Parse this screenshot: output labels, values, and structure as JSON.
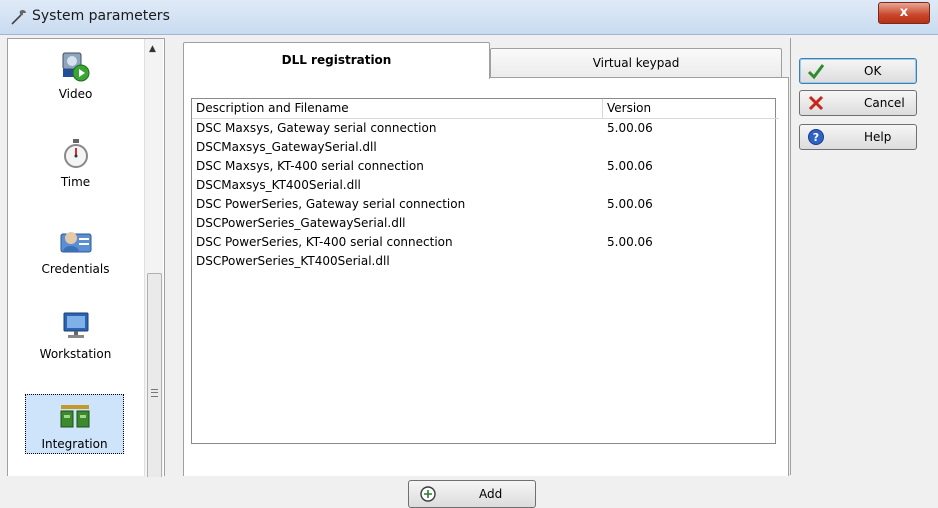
{
  "window": {
    "title": "System parameters",
    "close_label": "x"
  },
  "sidebar": {
    "items": [
      {
        "label": "Video"
      },
      {
        "label": "Time"
      },
      {
        "label": "Credentials"
      },
      {
        "label": "Workstation"
      },
      {
        "label": "Integration",
        "selected": true
      }
    ]
  },
  "tabs": [
    {
      "label": "DLL registration",
      "active": true
    },
    {
      "label": "Virtual keypad",
      "active": false
    }
  ],
  "dll_list": {
    "columns": [
      "Description and Filename",
      "Version"
    ],
    "rows": [
      {
        "description": "DSC Maxsys, Gateway serial connection",
        "version": "5.00.06",
        "filename": "DSCMaxsys_GatewaySerial.dll"
      },
      {
        "description": "DSC Maxsys, KT-400 serial connection",
        "version": "5.00.06",
        "filename": "DSCMaxsys_KT400Serial.dll"
      },
      {
        "description": "DSC PowerSeries, Gateway serial connection",
        "version": "5.00.06",
        "filename": "DSCPowerSeries_GatewaySerial.dll"
      },
      {
        "description": "DSC PowerSeries, KT-400 serial connection",
        "version": "5.00.06",
        "filename": "DSCPowerSeries_KT400Serial.dll"
      }
    ]
  },
  "add_button": {
    "label": "Add"
  },
  "actions": {
    "ok": "OK",
    "cancel": "Cancel",
    "help": "Help"
  }
}
